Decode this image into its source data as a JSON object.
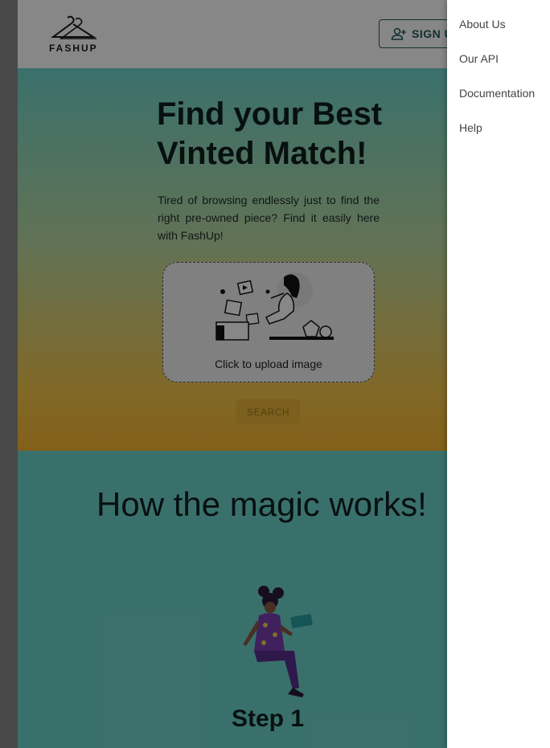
{
  "header": {
    "logo_text": "FASHUP",
    "signup_label": "SIGN UP"
  },
  "hero": {
    "title": "Find your Best Vinted Match!",
    "description": "Tired of browsing endlessly just to find the right pre-owned piece? Find it easily here with FashUp!",
    "upload_label": "Click to upload image",
    "search_label": "SEARCH"
  },
  "magic": {
    "title": "How the magic works!",
    "step_title": "Step 1"
  },
  "drawer": {
    "items": [
      {
        "label": "About Us"
      },
      {
        "label": "Our API"
      },
      {
        "label": "Documentation"
      },
      {
        "label": "Help"
      }
    ]
  },
  "colors": {
    "accent_teal": "#1f5d5a",
    "hero_top": "#6fd4cb",
    "hero_bottom": "#f6b631"
  },
  "icons": {
    "logo": "hanger-icon",
    "signup": "person-add-icon"
  }
}
